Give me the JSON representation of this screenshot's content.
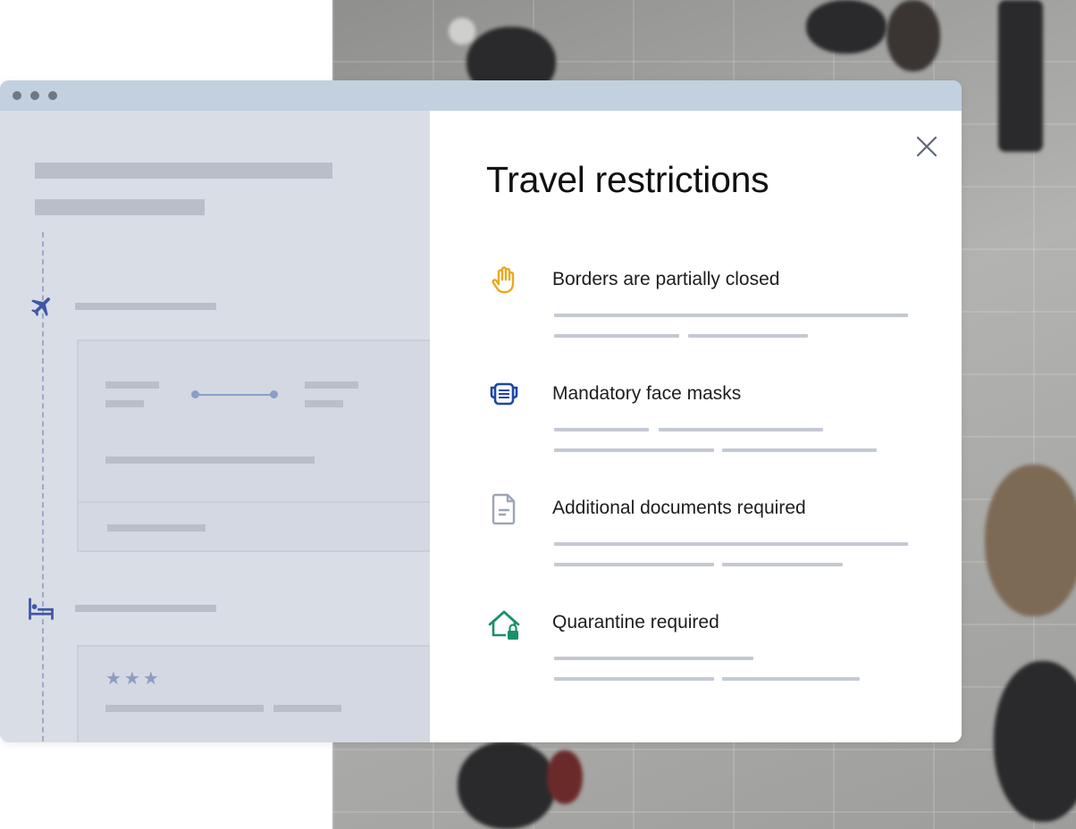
{
  "modal": {
    "title": "Travel restrictions",
    "close_icon": "close-icon"
  },
  "restrictions": [
    {
      "label": "Borders are partially closed",
      "icon": "hand-stop-icon",
      "color": "#E8A91F"
    },
    {
      "label": "Mandatory face masks",
      "icon": "face-mask-icon",
      "color": "#1E47A8"
    },
    {
      "label": "Additional documents required",
      "icon": "document-icon",
      "color": "#9DA5B4"
    },
    {
      "label": "Quarantine required",
      "icon": "house-lock-icon",
      "color": "#18906A"
    }
  ],
  "itinerary": {
    "flight_icon": "airplane-icon",
    "hotel_icon": "bed-icon",
    "hotel_rating": "★★★"
  },
  "colors": {
    "titlebar": "#C3D0E0",
    "window_background": "#D9DDE6",
    "modal_background": "#FFFFFF",
    "accent_blue": "#3E58A6"
  }
}
